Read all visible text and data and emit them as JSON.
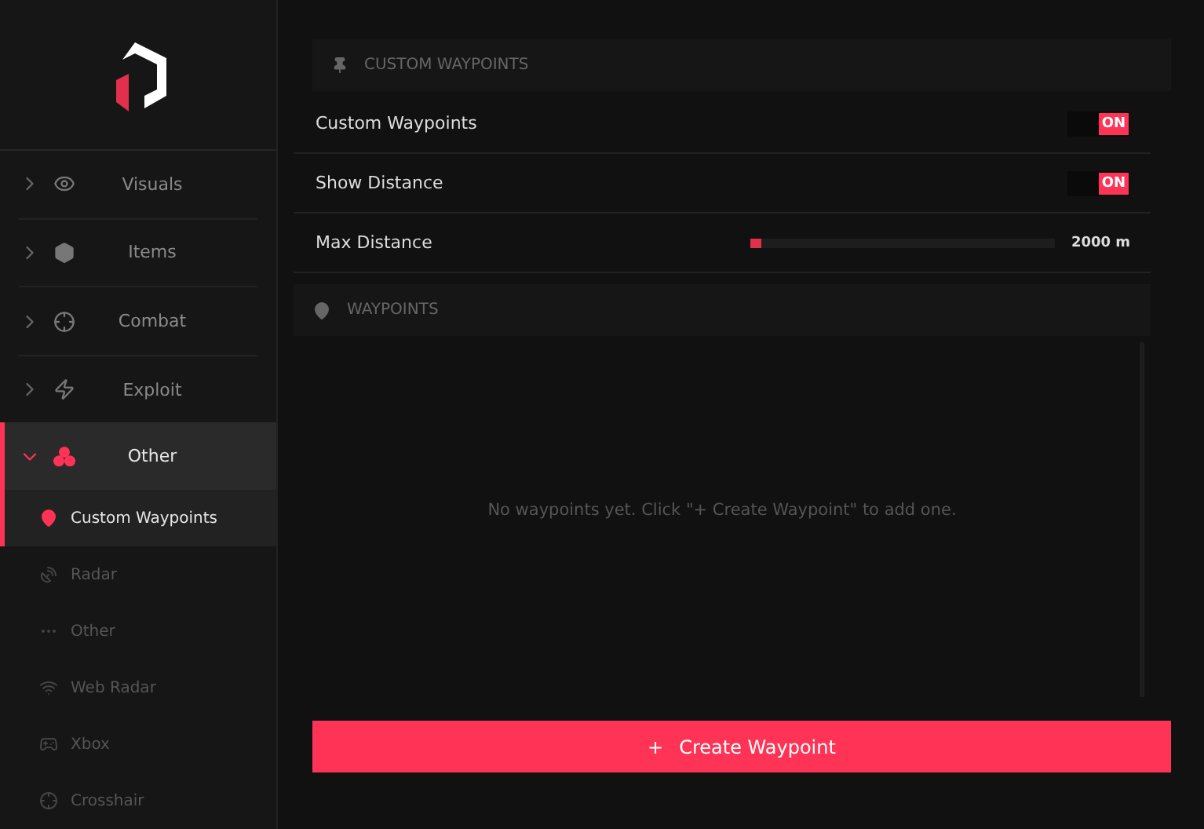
{
  "nav": [
    {
      "label": "Visuals",
      "kind": "eye",
      "expanded": false,
      "selected": false
    },
    {
      "label": "Items",
      "kind": "box",
      "expanded": false,
      "selected": false
    },
    {
      "label": "Combat",
      "kind": "crosshair",
      "expanded": false,
      "selected": false
    },
    {
      "label": "Exploit",
      "kind": "bolt",
      "expanded": false,
      "selected": false
    },
    {
      "label": "Other",
      "kind": "cubes",
      "expanded": true,
      "selected": true,
      "children": [
        {
          "label": "Custom Waypoints",
          "kind": "pin",
          "selected": true
        },
        {
          "label": "Radar",
          "kind": "dish",
          "selected": false
        },
        {
          "label": "Other",
          "kind": "dots",
          "selected": false
        },
        {
          "label": "Web Radar",
          "kind": "wifi",
          "selected": false
        },
        {
          "label": "Xbox",
          "kind": "gamepad",
          "selected": false
        },
        {
          "label": "Crosshair",
          "kind": "crosshair",
          "selected": false
        }
      ]
    }
  ],
  "section_title": "CUSTOM WAYPOINTS",
  "settings": [
    {
      "kind": "toggle",
      "label": "Custom Waypoints",
      "on": true,
      "state_label": "ON"
    },
    {
      "kind": "toggle",
      "label": "Show Distance",
      "on": true,
      "state_label": "ON"
    },
    {
      "kind": "slider",
      "label": "Max Distance",
      "level": 0.02,
      "reading": "2000 m"
    }
  ],
  "waypoints": {
    "title": "WAYPOINTS",
    "empty_text": "No waypoints yet. Click \"+ Create Waypoint\" to add one."
  },
  "create_button": {
    "icon_text": "+",
    "label": "Create Waypoint"
  }
}
